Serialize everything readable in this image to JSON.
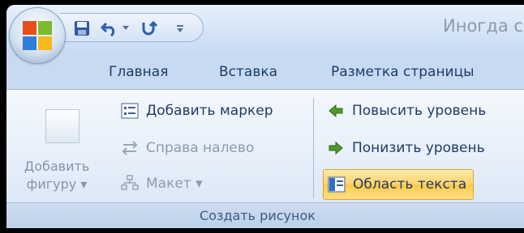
{
  "window": {
    "title": "Иногда сл"
  },
  "quick_access": {
    "buttons": [
      "save-icon",
      "undo-icon",
      "redo-icon",
      "customize-icon"
    ]
  },
  "tabs": [
    "Главная",
    "Вставка",
    "Разметка страницы"
  ],
  "ribbon": {
    "group_label": "Создать рисунок",
    "add_shape": {
      "line1": "Добавить",
      "line2": "фигуру ▾"
    },
    "add_bullet": "Добавить маркер",
    "right_to_left": "Справа налево",
    "layout": "Макет ▾",
    "promote": "Повысить уровень",
    "demote": "Понизить уровень",
    "text_pane": "Область текста"
  },
  "colors": {
    "accent": "#1f3b66",
    "selected": "#ffd46b",
    "disabled": "#8f9aab"
  }
}
